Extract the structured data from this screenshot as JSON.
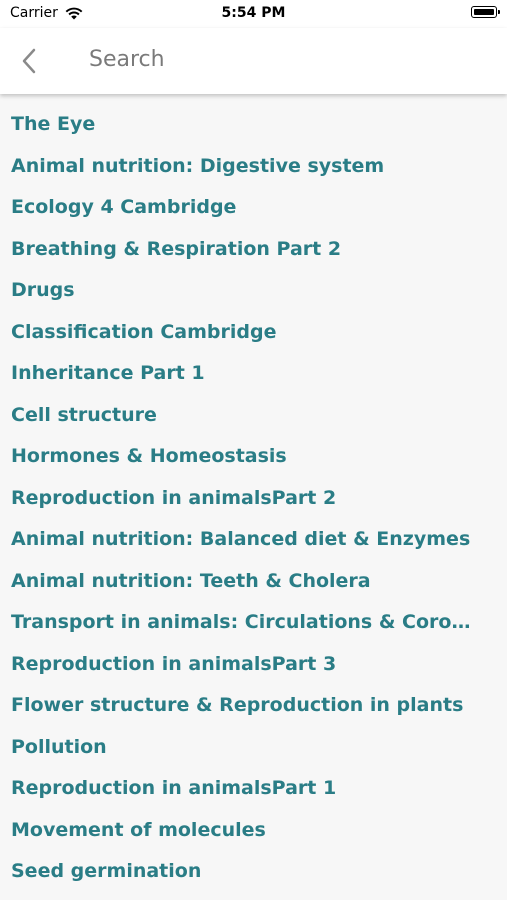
{
  "status_bar": {
    "carrier": "Carrier",
    "time": "5:54 PM",
    "icons": [
      "wifi-icon",
      "battery-icon"
    ]
  },
  "nav": {
    "back_icon": "chevron-left-icon",
    "title": "Search"
  },
  "colors": {
    "item_text": "#2a7d86",
    "background": "#f7f7f7",
    "nav_background": "#ffffff"
  },
  "topics": [
    "The Eye",
    "Animal nutrition: Digestive system",
    "Ecology 4 Cambridge",
    "Breathing & Respiration Part 2",
    "Drugs",
    "Classification Cambridge",
    "Inheritance Part 1",
    "Cell structure",
    "Hormones & Homeostasis",
    "Reproduction in animalsPart 2",
    "Animal nutrition: Balanced diet & Enzymes",
    "Animal nutrition: Teeth & Cholera",
    "Transport in animals: Circulations & Coronary ...",
    "Reproduction in animalsPart 3",
    "Flower structure & Reproduction in plants",
    "Pollution",
    "Reproduction in animalsPart 1",
    "Movement of molecules",
    "Seed germination"
  ]
}
